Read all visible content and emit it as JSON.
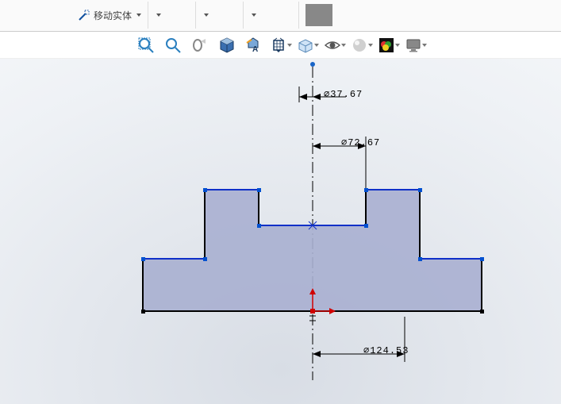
{
  "ribbon": {
    "move_entity_label": "移动实体"
  },
  "dimensions": {
    "d1": "⌀37.67",
    "d2": "⌀72.67",
    "d3": "⌀124.53"
  }
}
